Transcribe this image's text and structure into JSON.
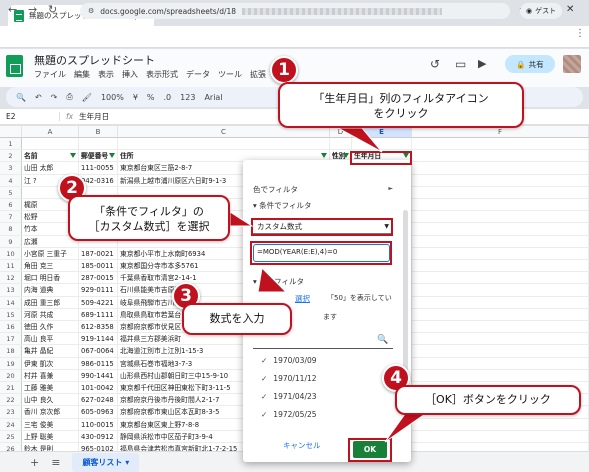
{
  "browser": {
    "tab_title": "無題のスプレッドシート - Google ス",
    "url": "docs.google.com/spreadsheets/d/18",
    "guest_label": "ゲスト"
  },
  "sheets": {
    "doc_title": "無題のスプレッドシート",
    "menu": [
      "ファイル",
      "編集",
      "表示",
      "挿入",
      "表示形式",
      "データ",
      "ツール",
      "拡張"
    ],
    "share_label": "共有",
    "zoom": "100%",
    "font": "Arial",
    "toolbar_123": "123",
    "cell_ref": "E2",
    "formula_value": "生年月日"
  },
  "grid": {
    "columns": [
      "A",
      "B",
      "C",
      "D",
      "E",
      "F"
    ],
    "headers": [
      "名前",
      "郵便番号",
      "住所",
      "性別",
      "生年月日"
    ],
    "rows": [
      [
        "山田 太郎",
        "111-0055",
        "東京都台東区三筋2-8-7"
      ],
      [
        "江 ?",
        "942-0316",
        "新潟県上越市浦川原区六日町9-1-3"
      ],
      [
        "",
        "",
        ""
      ],
      [
        "梶原",
        "",
        ""
      ],
      [
        "松野",
        "",
        ""
      ],
      [
        "竹本",
        "",
        ""
      ],
      [
        "広瀬",
        "",
        ""
      ],
      [
        "小宮原 三重子",
        "187-0021",
        "東京都小平市上水南町6934"
      ],
      [
        "角田 克三",
        "185-0011",
        "東京都国分寺市本多5761"
      ],
      [
        "堀口 明日香",
        "287-0015",
        "千葉県香取市清宮2-14-1"
      ],
      [
        "内海 道典",
        "929-0111",
        "石川県能美市吉原町"
      ],
      [
        "成田 重三郎",
        "509-4221",
        "岐阜県飛騨市古川町"
      ],
      [
        "河原 共成",
        "689-1111",
        "鳥取県鳥取市若葉台"
      ],
      [
        "徳田 久作",
        "612-8358",
        "京都府京都市伏見区"
      ],
      [
        "高山 良平",
        "919-1144",
        "福井県三方郡美浜町"
      ],
      [
        "亀井 晶紀",
        "067-0064",
        "北海道江別市上江別1-15-3"
      ],
      [
        "伊東 凱次",
        "986-0115",
        "宮城県石巻市福地3-7-3"
      ],
      [
        "村井 喜兼",
        "990-1441",
        "山形県西村山郡朝日町三中15-9-10"
      ],
      [
        "工藤 雅美",
        "101-0042",
        "東京都千代田区神田東松下町3-11-5"
      ],
      [
        "山中 良久",
        "627-0248",
        "京都府京丹後市丹後町間人2-1-7"
      ],
      [
        "香川 京次郎",
        "605-0963",
        "京都府京都市東山区本瓦町8-3-5"
      ],
      [
        "三宅 俊美",
        "110-0015",
        "東京都台東区東上野7-8-8"
      ],
      [
        "上野 聡美",
        "430-0912",
        "静岡県浜松市中区茄子町3-9-4"
      ],
      [
        "鈴木 是則",
        "965-0102",
        "福島県会津若松市真宮新町北1-7-2-15"
      ]
    ],
    "row_numbers": [
      "1",
      "2",
      "3",
      "4",
      "5",
      "6",
      "7",
      "8",
      "9",
      "10",
      "11",
      "12",
      "13",
      "14",
      "15",
      "16",
      "17",
      "18",
      "19",
      "20",
      "21",
      "22",
      "23",
      "24",
      "25",
      "26"
    ]
  },
  "sheet_tab": "顧客リスト",
  "filter_panel": {
    "color_filter": "色でフィルタ",
    "condition_filter": "条件でフィルタ",
    "condition_select": "カスタム数式",
    "formula_input": "=MOD(YEAR(E:E),4)=0",
    "value_filter": "値でフィルタ",
    "select_all": "選択",
    "showing": "「50」を表示してい",
    "showing2": "ます",
    "values": [
      "1970/03/09",
      "1970/11/12",
      "1971/04/23",
      "1972/05/25"
    ],
    "cancel": "キャンセル",
    "ok": "OK"
  },
  "annotations": {
    "step1": "1",
    "step1_text_a": "「生年月日」列のフィルタアイコン",
    "step1_text_b": "をクリック",
    "step2": "2",
    "step2_text_a": "「条件でフィルタ」の",
    "step2_text_b": "［カスタム数式］を選択",
    "step3": "3",
    "step3_text": "数式を入力",
    "step4": "4",
    "step4_text": "［OK］ボタンをクリック"
  },
  "colors": {
    "accent_red": "#c0111f",
    "sheets_green": "#0f9d58",
    "ok_green": "#188038",
    "selection_blue": "#1a73e8"
  }
}
